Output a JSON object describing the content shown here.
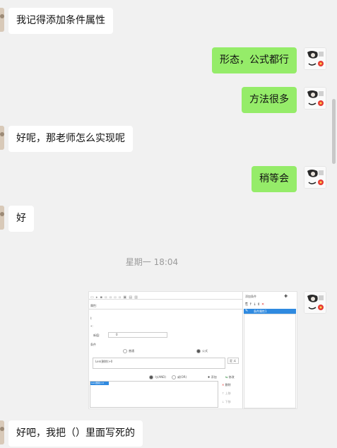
{
  "messages": [
    {
      "side": "left",
      "text": "我记得添加条件属性"
    },
    {
      "side": "right",
      "text": "形态，公式都行"
    },
    {
      "side": "right",
      "text": "方法很多"
    },
    {
      "side": "left",
      "text": "好呢，那老师怎么实现呢"
    },
    {
      "side": "right",
      "text": "稍等会"
    },
    {
      "side": "left",
      "text": "好"
    },
    {
      "side": "left",
      "text": "好吧，我把（）里面写死的"
    }
  ],
  "timestamp": "星期一 18:04",
  "screenshot": {
    "prop_label": "属性:",
    "new_label": "新值:",
    "new_value": "0",
    "cond_header": "条件",
    "mode_normal": "普通",
    "mode_formula": "公式",
    "formula": "Len(删除)>0",
    "define_label": "定 义",
    "radio_and": "与(AND)",
    "radio_or": "或(OR)",
    "add_label": "添加",
    "modify_label": "修改",
    "delete_label": "删除",
    "up_label": "上移",
    "down_label": "下移",
    "panel_title": "添加条件",
    "list_item": "条件属性1",
    "selected_row": "Len(删除)>0"
  },
  "colors": {
    "background": "#f1f1f1",
    "bubble_left": "#ffffff",
    "bubble_right": "#95ec69",
    "timestamp": "#9b9b9b",
    "selection": "#2f8ae0"
  }
}
